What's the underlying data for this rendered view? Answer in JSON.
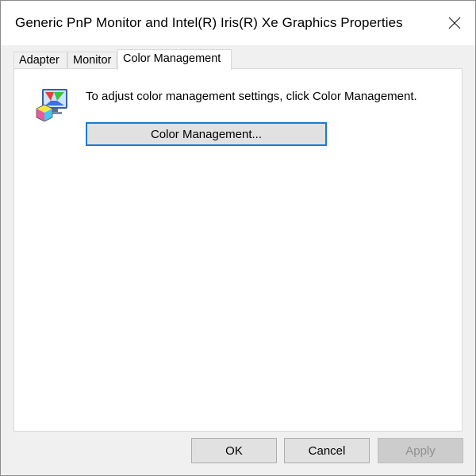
{
  "window": {
    "title": "Generic PnP Monitor and Intel(R) Iris(R) Xe Graphics Properties",
    "close_icon": "close-icon"
  },
  "tabs": [
    {
      "label": "Adapter",
      "active": false
    },
    {
      "label": "Monitor",
      "active": false
    },
    {
      "label": "Color Management",
      "active": true
    }
  ],
  "color_management": {
    "icon": "color-management-icon",
    "description": "To adjust color management settings, click Color Management.",
    "button_label": "Color Management..."
  },
  "footer": {
    "ok_label": "OK",
    "cancel_label": "Cancel",
    "apply_label": "Apply",
    "apply_enabled": false
  },
  "colors": {
    "focus_border": "#1a7bd1",
    "dialog_bg": "#f0f0f0",
    "panel_bg": "#ffffff",
    "disabled_text": "#8f8f8f"
  }
}
